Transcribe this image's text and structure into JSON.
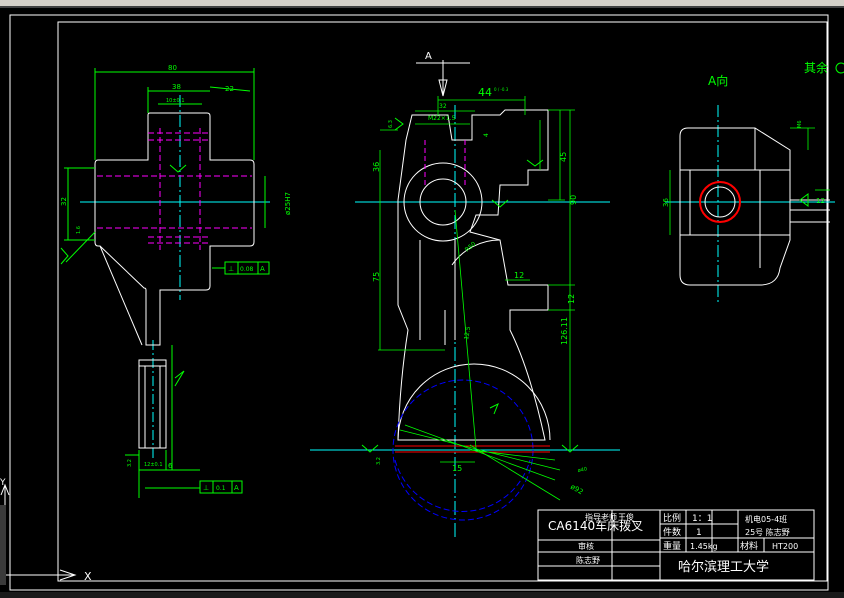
{
  "colors": {
    "background": "#000000",
    "outline": "#ffffff",
    "dimension": "#00ff00",
    "centerline": "#00ffff",
    "hidden": "#ff00ff",
    "cut": "#ff0000",
    "section": "#0000ff",
    "text": "#00ff00",
    "titleblock_text": "#ffffff"
  },
  "views": {
    "section_arrow_label": "A",
    "view_a_label": "A向",
    "other_surfaces_note": "其余"
  },
  "dimensions": {
    "left": {
      "overall_width": "80",
      "top_width": "38",
      "sub_width": "22",
      "slot_width": "10±0.1",
      "bore": "ø25H7",
      "height_32": "32",
      "roughness_1": "1.6",
      "roughness_2": "3.2",
      "bottom_width": "12±0.1",
      "bottom_offset": "6",
      "tol_frame_1": [
        "⊥",
        "0.08",
        "A"
      ],
      "tol_frame_2": [
        "⊥",
        "0.1",
        "A"
      ]
    },
    "middle": {
      "top_width": "44",
      "top_width_tol": "0 / -0.3",
      "inner_width": "32",
      "thread": "M22×1.5",
      "h_36": "36",
      "h_45": "45",
      "h_90": "90",
      "h_75": "75",
      "h_12": "12",
      "h_12b": "12",
      "h_126": "126.11",
      "radius": "R50",
      "roughness_6_3": "6.3",
      "roughness_12_5": "12.5",
      "angle_15": "15",
      "dia_92": "ø92",
      "dia_small": "ø40",
      "roughness_3_2": "3.2",
      "dim_4": "4"
    },
    "right": {
      "m6": "M6",
      "d_36": "36",
      "d_12": "12"
    }
  },
  "title_block": {
    "part_name": "CA6140车床拨叉",
    "row1": [
      "指导老师",
      "王俊"
    ],
    "row2": [
      "审核",
      ""
    ],
    "row3": [
      "陈志野",
      ""
    ],
    "scale_label": "比例",
    "scale_value": "1：1",
    "qty_label": "件数",
    "qty_value": "1",
    "weight_label": "重量",
    "weight_value": "1.45kg",
    "material_label": "材料",
    "material_value": "HT200",
    "class": "机电05-4班",
    "student": "25号 陈志野",
    "school": "哈尔滨理工大学"
  },
  "ucs": {
    "x_label": "X",
    "y_label": "Y"
  }
}
